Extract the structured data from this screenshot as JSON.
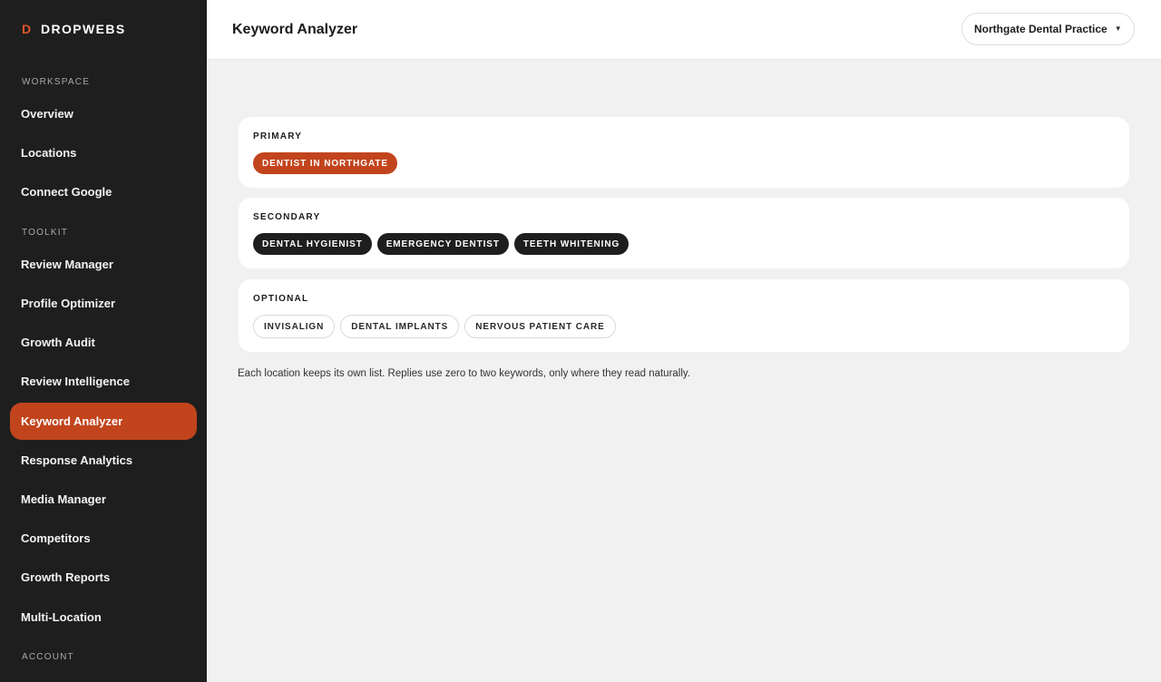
{
  "brand": {
    "mark": "D",
    "name": "DROPWEBS"
  },
  "sidebar": {
    "sections": [
      {
        "label": "WORKSPACE"
      },
      {
        "label": "TOOLKIT"
      },
      {
        "label": "ACCOUNT"
      }
    ],
    "items": [
      {
        "label": "Overview"
      },
      {
        "label": "Locations"
      },
      {
        "label": "Connect Google"
      },
      {
        "label": "Review Manager"
      },
      {
        "label": "Profile Optimizer"
      },
      {
        "label": "Growth Audit"
      },
      {
        "label": "Review Intelligence"
      },
      {
        "label": "Keyword Analyzer",
        "active": true
      },
      {
        "label": "Response Analytics"
      },
      {
        "label": "Media Manager"
      },
      {
        "label": "Competitors"
      },
      {
        "label": "Growth Reports"
      },
      {
        "label": "Multi-Location"
      }
    ]
  },
  "header": {
    "title": "Keyword Analyzer",
    "location_select": {
      "value": "Northgate Dental Practice",
      "icon": "chevron-down-icon"
    }
  },
  "keywords": {
    "primary": {
      "title": "PRIMARY",
      "chips": [
        "DENTIST IN NORTHGATE"
      ]
    },
    "secondary": {
      "title": "SECONDARY",
      "chips": [
        "DENTAL HYGIENIST",
        "EMERGENCY DENTIST",
        "TEETH WHITENING"
      ]
    },
    "optional": {
      "title": "OPTIONAL",
      "chips": [
        "INVISALIGN",
        "DENTAL IMPLANTS",
        "NERVOUS PATIENT CARE"
      ]
    }
  },
  "footnote": "Each location keeps its own list. Replies use zero to two keywords, only where they read naturally.",
  "colors": {
    "accent": "#c2441d",
    "sidebar_bg": "#1e1e1e",
    "page_bg": "#f1f1f1"
  }
}
